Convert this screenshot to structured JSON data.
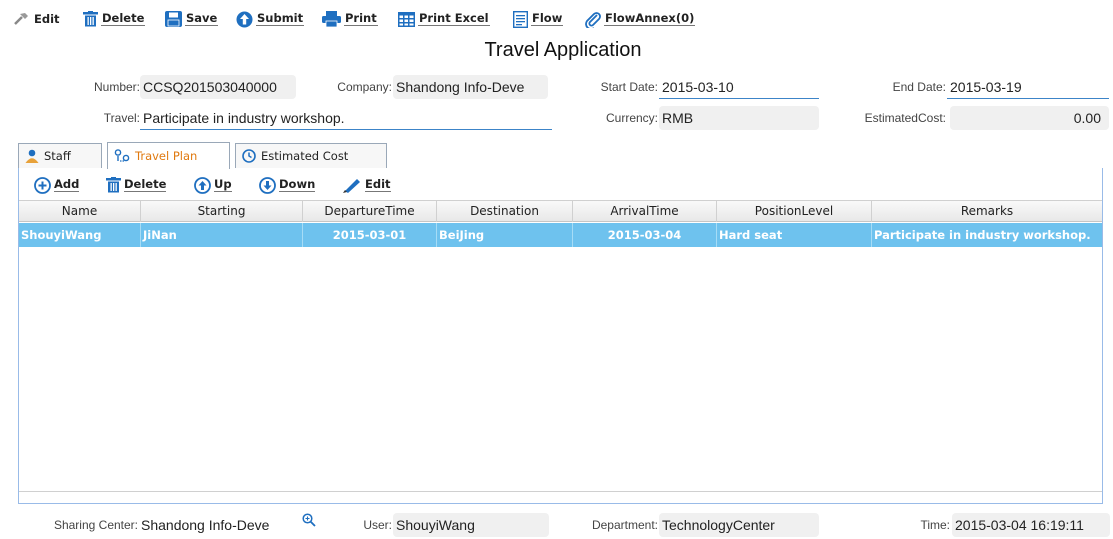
{
  "toolbar": {
    "edit": "Edit",
    "delete": "Delete",
    "save": "Save",
    "submit": "Submit",
    "print": "Print",
    "print_excel": "Print Excel",
    "flow": "Flow",
    "flow_annex": "FlowAnnex(0)"
  },
  "title": "Travel Application",
  "form": {
    "number_label": "Number:",
    "number_value": "CCSQ201503040000",
    "company_label": "Company:",
    "company_value": "Shandong Info-Deve",
    "start_date_label": "Start Date:",
    "start_date_value": "2015-03-10",
    "end_date_label": "End Date:",
    "end_date_value": "2015-03-19",
    "travel_label": "Travel:",
    "travel_value": "Participate in industry workshop.",
    "currency_label": "Currency:",
    "currency_value": "RMB",
    "estimated_cost_label": "EstimatedCost:",
    "estimated_cost_value": "0.00"
  },
  "tabs": [
    {
      "label": "Staff"
    },
    {
      "label": "Travel Plan"
    },
    {
      "label": "Estimated Cost"
    }
  ],
  "grid_toolbar": {
    "add": "Add",
    "delete": "Delete",
    "up": "Up",
    "down": "Down",
    "edit": "Edit"
  },
  "grid": {
    "columns": [
      "Name",
      "Starting",
      "DepartureTime",
      "Destination",
      "ArrivalTime",
      "PositionLevel",
      "Remarks"
    ],
    "rows": [
      [
        "ShouyiWang",
        "JiNan",
        "2015-03-01",
        "BeiJing",
        "2015-03-04",
        "Hard seat",
        "Participate in industry workshop."
      ]
    ]
  },
  "footer": {
    "sharing_center_label": "Sharing Center:",
    "sharing_center_value": "Shandong Info-Deve",
    "user_label": "User:",
    "user_value": "ShouyiWang",
    "department_label": "Department:",
    "department_value": "TechnologyCenter",
    "time_label": "Time:",
    "time_value": "2015-03-04 16:19:11"
  },
  "colors": {
    "selected_row": "#6ec2ee",
    "active_tab_text": "#e07a10",
    "icon_blue": "#1f6fc0",
    "field_underline": "#3c84c8"
  }
}
